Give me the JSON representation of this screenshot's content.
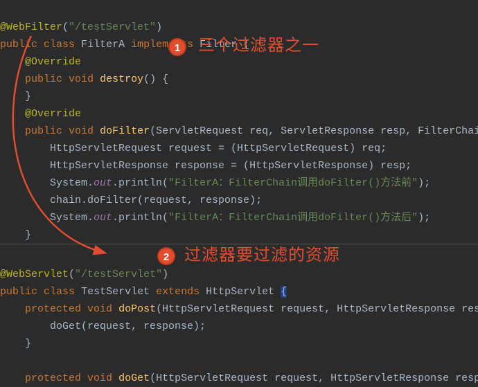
{
  "top": {
    "l1_ann": "@WebFilter",
    "l1_str": "\"/testServlet\"",
    "l2_a": "public",
    "l2_b": "class",
    "l2_c": "FilterA",
    "l2_d": "implements",
    "l2_e": "Filter",
    "override": "@Override",
    "l4_a": "public",
    "l4_b": "void",
    "l4_c": "destroy",
    "l8_a": "public",
    "l8_b": "void",
    "l8_c": "doFilter",
    "l8_p": "(ServletRequest req, ServletResponse resp, FilterChain chai",
    "l9": "HttpServletRequest request = (HttpServletRequest) req;",
    "l10": "HttpServletResponse response = (HttpServletResponse) resp;",
    "l11_a": "System.",
    "l11_b": "out",
    "l11_c": ".println(",
    "l11_str": "\"FilterA：FilterChain调用doFilter()方法前\"",
    "l11_d": ");",
    "l12": "chain.doFilter(request, response);",
    "l13_str": "\"FilterA：FilterChain调用doFilter()方法后\""
  },
  "bottom": {
    "l1_ann": "@WebServlet",
    "l1_str": "\"/testServlet\"",
    "l2_a": "public",
    "l2_b": "class",
    "l2_c": "TestServlet",
    "l2_d": "extends",
    "l2_e": "HttpServlet",
    "l3_a": "protected",
    "l3_b": "void",
    "l3_c": "doPost",
    "l3_p": "(HttpServletRequest request, HttpServletResponse response)",
    "l4": "doGet(request, response);",
    "l7_a": "protected",
    "l7_b": "void",
    "l7_c": "doGet",
    "l7_p": "(HttpServletRequest request, HttpServletResponse response)"
  },
  "badges": {
    "one": "1",
    "two": "2"
  },
  "annotations": {
    "a1": "三个过滤器之一",
    "a2": "过滤器要过滤的资源"
  }
}
